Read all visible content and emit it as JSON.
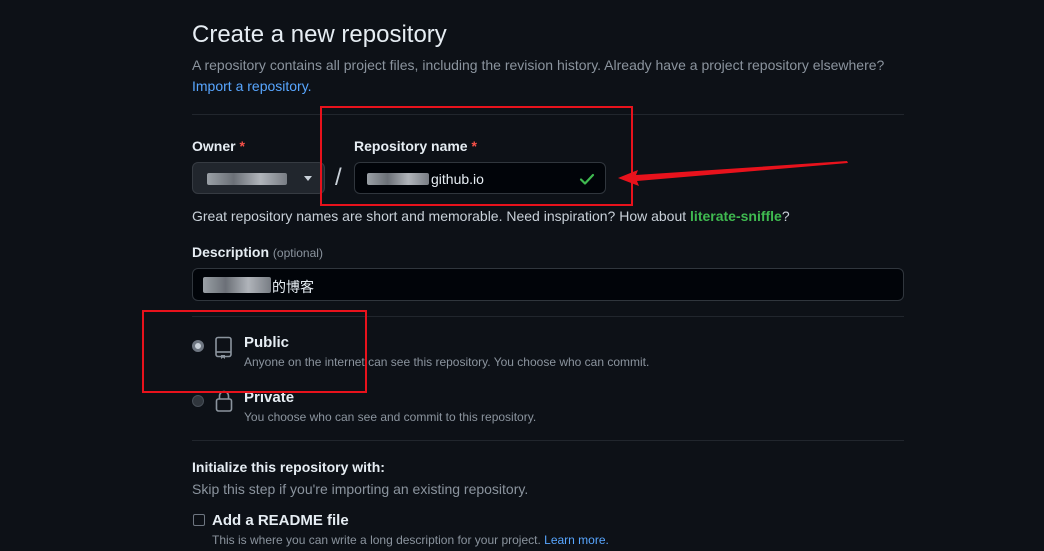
{
  "header": {
    "title": "Create a new repository",
    "subtitle": "A repository contains all project files, including the revision history. Already have a project repository elsewhere?",
    "import_link": "Import a repository."
  },
  "owner": {
    "label": "Owner",
    "required_mark": "*"
  },
  "repo": {
    "label": "Repository name",
    "required_mark": "*",
    "separator": "/",
    "value_visible": "github.io"
  },
  "hint": {
    "prefix": "Great repository names are short and memorable. Need inspiration? How about ",
    "suggestion": "literate-sniffle",
    "suffix": "?"
  },
  "description": {
    "label": "Description",
    "optional": "(optional)",
    "value_visible": "的博客"
  },
  "visibility": {
    "public": {
      "title": "Public",
      "desc": "Anyone on the internet can see this repository. You choose who can commit.",
      "selected": true
    },
    "private": {
      "title": "Private",
      "desc": "You choose who can see and commit to this repository.",
      "selected": false
    }
  },
  "init": {
    "title": "Initialize this repository with:",
    "subtitle": "Skip this step if you're importing an existing repository.",
    "readme_label": "Add a README file",
    "readme_desc": "This is where you can write a long description for your project. ",
    "learn_more": "Learn more."
  },
  "colors": {
    "background": "#0d1117",
    "link": "#58a6ff",
    "success": "#3fb950",
    "annotation_red": "#e8121c"
  },
  "icons": {
    "repo_valid": "check-icon",
    "public": "repo-book-icon",
    "private": "lock-icon",
    "owner_dropdown": "caret-down-icon"
  }
}
